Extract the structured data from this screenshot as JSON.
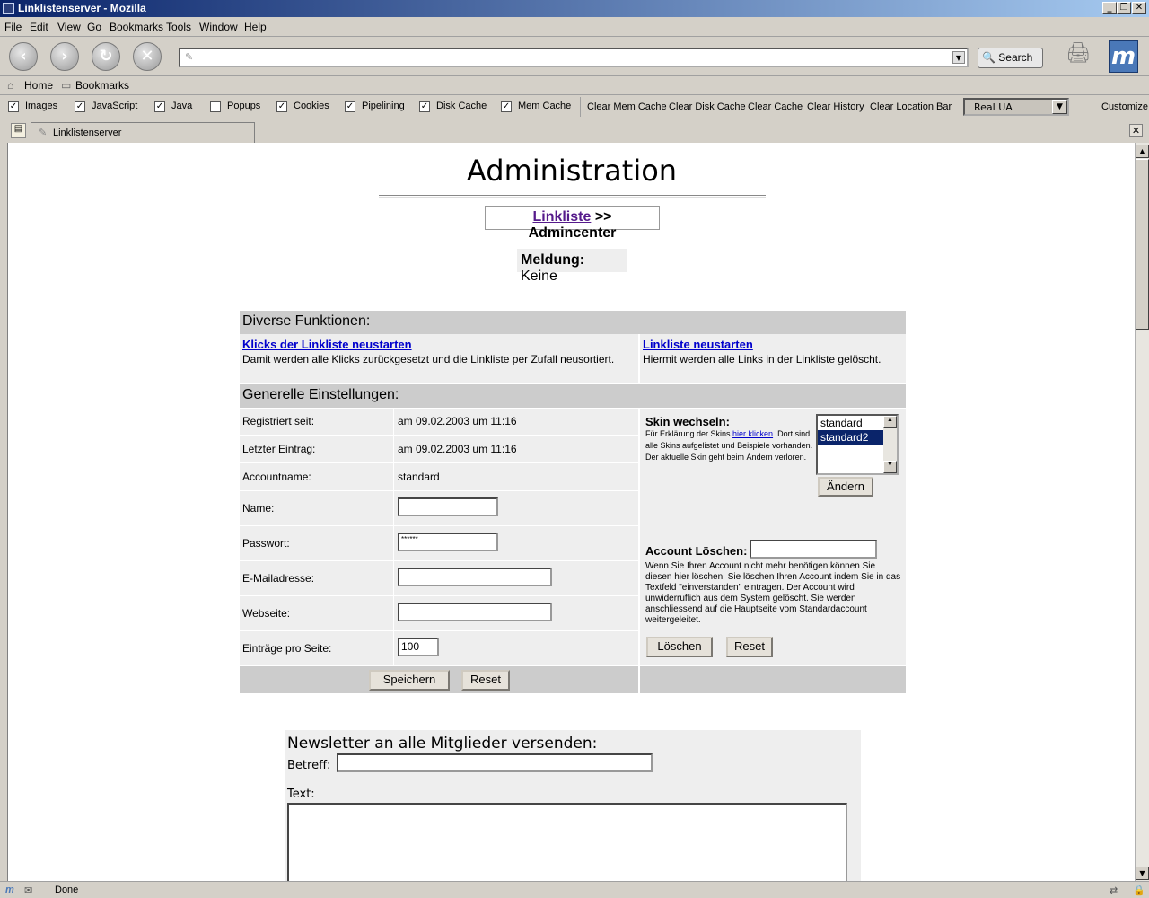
{
  "window": {
    "title": "Linklistenserver - Mozilla"
  },
  "menu": [
    "File",
    "Edit",
    "View",
    "Go",
    "Bookmarks",
    "Tools",
    "Window",
    "Help"
  ],
  "nav": {
    "search_label": "Search",
    "url_value": ""
  },
  "personal_bar": {
    "home": "Home",
    "bookmarks": "Bookmarks"
  },
  "prefbar": {
    "checks": [
      {
        "label": "Images",
        "checked": true
      },
      {
        "label": "JavaScript",
        "checked": true
      },
      {
        "label": "Java",
        "checked": true
      },
      {
        "label": "Popups",
        "checked": false
      },
      {
        "label": "Cookies",
        "checked": true
      },
      {
        "label": "Pipelining",
        "checked": true
      },
      {
        "label": "Disk Cache",
        "checked": true
      },
      {
        "label": "Mem Cache",
        "checked": true
      }
    ],
    "actions": [
      "Clear Mem Cache",
      "Clear Disk Cache",
      "Clear Cache",
      "Clear History",
      "Clear Location Bar"
    ],
    "ua_select": "Real UA",
    "customize": "Customize"
  },
  "tab": {
    "label": "Linklistenserver"
  },
  "page": {
    "title": "Administration",
    "crumb_link": "Linkliste",
    "crumb_rest": ">> Admincenter",
    "meldung_label": "Meldung:",
    "meldung_value": "Keine",
    "diverse": {
      "header": "Diverse Funktionen:",
      "left_link": "Klicks der Linkliste neustarten",
      "left_text": "Damit werden alle Klicks zurückgesetzt und die Linkliste per Zufall neusortiert.",
      "right_link": "Linkliste neustarten",
      "right_text": "Hiermit werden alle Links in der Linkliste gelöscht."
    },
    "general": {
      "header": "Generelle Einstellungen:",
      "rows": [
        {
          "label": "Registriert seit:",
          "value": "am 09.02.2003 um 11:16"
        },
        {
          "label": "Letzter Eintrag:",
          "value": "am 09.02.2003 um 11:16"
        },
        {
          "label": "Accountname:",
          "value": "standard"
        }
      ],
      "name_label": "Name:",
      "name_value": "",
      "password_label": "Passwort:",
      "password_value": "******",
      "email_label": "E-Mailadresse:",
      "email_value": "",
      "web_label": "Webseite:",
      "web_value": "",
      "perpage_label": "Einträge pro Seite:",
      "perpage_value": "100",
      "save_button": "Speichern",
      "reset_button": "Reset"
    },
    "skin": {
      "title": "Skin wechseln:",
      "desc_pre": "Für Erklärung der Skins ",
      "desc_link": "hier klicken",
      "desc_post": ". Dort sind alle Skins aufgelistet und Beispiele vorhanden. Der aktuelle Skin geht beim Ändern verloren.",
      "options": [
        "standard",
        "standard2"
      ],
      "selected": "standard2",
      "change_button": "Ändern"
    },
    "delete": {
      "title": "Account Löschen:",
      "input_value": "",
      "text": "Wenn Sie Ihren Account nicht mehr benötigen können Sie diesen hier löschen. Sie löschen Ihren Account indem Sie in das Textfeld \"einverstanden\" eintragen. Der Account wird unwiderruflich aus dem System gelöscht. Sie werden anschliessend auf die Hauptseite vom Standardaccount weitergeleitet.",
      "delete_button": "Löschen",
      "reset_button": "Reset"
    },
    "newsletter": {
      "title": "Newsletter an alle Mitglieder versenden:",
      "subject_label": "Betreff:",
      "subject_value": "",
      "text_label": "Text:",
      "text_value": ""
    }
  },
  "status": {
    "text": "Done"
  }
}
